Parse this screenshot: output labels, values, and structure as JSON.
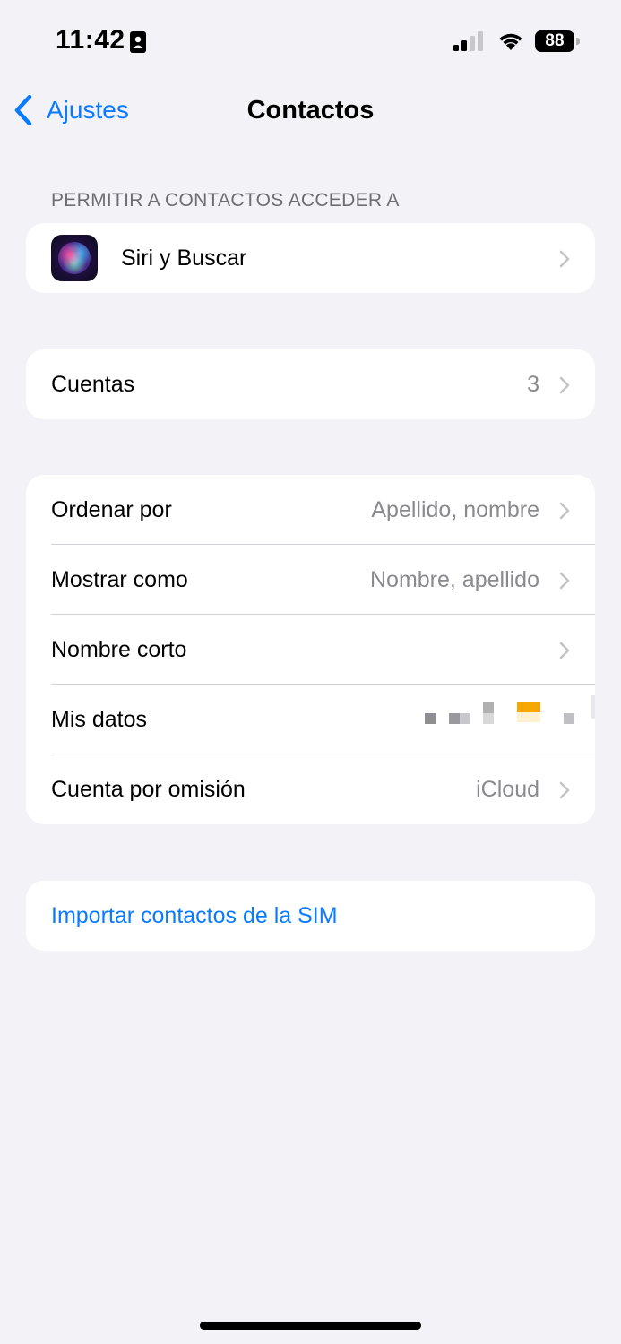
{
  "status_bar": {
    "time": "11:42",
    "battery_level": "88",
    "icons": [
      "focus-icon",
      "signal-icon",
      "wifi-icon",
      "battery-icon"
    ]
  },
  "nav": {
    "back_label": "Ajustes",
    "title": "Contactos"
  },
  "section_access": {
    "header": "PERMITIR A CONTACTOS ACCEDER A",
    "items": [
      {
        "label": "Siri y Buscar",
        "icon": "siri-icon"
      }
    ]
  },
  "section_accounts": {
    "items": [
      {
        "label": "Cuentas",
        "value": "3"
      }
    ]
  },
  "section_display": {
    "items": [
      {
        "label": "Ordenar por",
        "value": "Apellido, nombre"
      },
      {
        "label": "Mostrar como",
        "value": "Nombre, apellido"
      },
      {
        "label": "Nombre corto",
        "value": ""
      },
      {
        "label": "Mis datos",
        "value": ""
      },
      {
        "label": "Cuenta por omisión",
        "value": "iCloud"
      }
    ]
  },
  "section_import": {
    "link_label": "Importar contactos de la SIM"
  },
  "colors": {
    "accent": "#0a7aff",
    "background": "#f2f2f7",
    "secondary_text": "#8a8a8e"
  }
}
